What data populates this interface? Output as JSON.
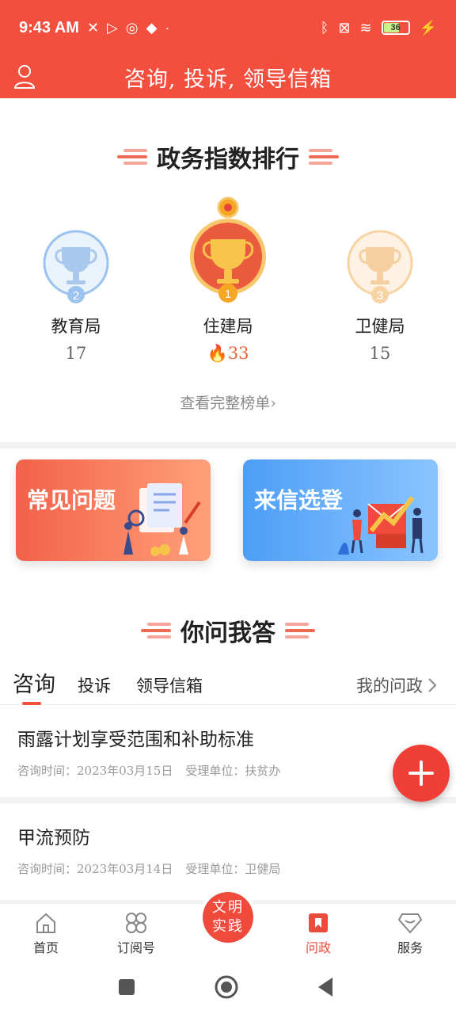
{
  "status_bar": {
    "time": "9:43 AM",
    "battery": "36"
  },
  "header": {
    "title": "咨询, 投诉, 领导信箱"
  },
  "ranking": {
    "title": "政务指数排行",
    "items": [
      {
        "rank": "2",
        "dept": "教育局",
        "score": "17"
      },
      {
        "rank": "1",
        "dept": "住建局",
        "score": "33"
      },
      {
        "rank": "3",
        "dept": "卫健局",
        "score": "15"
      }
    ],
    "full_list": "查看完整榜单"
  },
  "cards": {
    "faq": "常见问题",
    "letters": "来信选登"
  },
  "qa": {
    "title": "你问我答",
    "tabs": [
      "咨询",
      "投诉",
      "领导信箱"
    ],
    "my_questions": "我的问政",
    "items": [
      {
        "title": "雨露计划享受范围和补助标准",
        "time": "咨询时间：2023年03月15日",
        "unit": "受理单位：扶贫办"
      },
      {
        "title": "甲流预防",
        "time": "咨询时间：2023年03月14日",
        "unit": "受理单位：卫健局"
      }
    ]
  },
  "bottom_nav": {
    "home": "首页",
    "subscribe": "订阅号",
    "center": [
      "文明",
      "实践"
    ],
    "wenzheng": "问政",
    "service": "服务"
  },
  "colors": {
    "accent": "#f24f3f",
    "blue": "#4d9ef7",
    "gold": "#f5a623"
  }
}
